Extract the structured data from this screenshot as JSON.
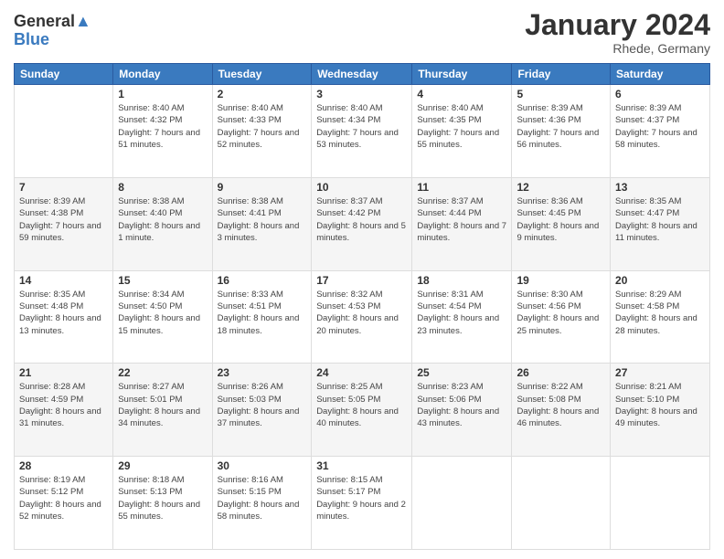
{
  "logo": {
    "general": "General",
    "blue": "Blue"
  },
  "title": "January 2024",
  "location": "Rhede, Germany",
  "days_of_week": [
    "Sunday",
    "Monday",
    "Tuesday",
    "Wednesday",
    "Thursday",
    "Friday",
    "Saturday"
  ],
  "weeks": [
    [
      {
        "day": "",
        "sunrise": "",
        "sunset": "",
        "daylight": ""
      },
      {
        "day": "1",
        "sunrise": "Sunrise: 8:40 AM",
        "sunset": "Sunset: 4:32 PM",
        "daylight": "Daylight: 7 hours and 51 minutes."
      },
      {
        "day": "2",
        "sunrise": "Sunrise: 8:40 AM",
        "sunset": "Sunset: 4:33 PM",
        "daylight": "Daylight: 7 hours and 52 minutes."
      },
      {
        "day": "3",
        "sunrise": "Sunrise: 8:40 AM",
        "sunset": "Sunset: 4:34 PM",
        "daylight": "Daylight: 7 hours and 53 minutes."
      },
      {
        "day": "4",
        "sunrise": "Sunrise: 8:40 AM",
        "sunset": "Sunset: 4:35 PM",
        "daylight": "Daylight: 7 hours and 55 minutes."
      },
      {
        "day": "5",
        "sunrise": "Sunrise: 8:39 AM",
        "sunset": "Sunset: 4:36 PM",
        "daylight": "Daylight: 7 hours and 56 minutes."
      },
      {
        "day": "6",
        "sunrise": "Sunrise: 8:39 AM",
        "sunset": "Sunset: 4:37 PM",
        "daylight": "Daylight: 7 hours and 58 minutes."
      }
    ],
    [
      {
        "day": "7",
        "sunrise": "Sunrise: 8:39 AM",
        "sunset": "Sunset: 4:38 PM",
        "daylight": "Daylight: 7 hours and 59 minutes."
      },
      {
        "day": "8",
        "sunrise": "Sunrise: 8:38 AM",
        "sunset": "Sunset: 4:40 PM",
        "daylight": "Daylight: 8 hours and 1 minute."
      },
      {
        "day": "9",
        "sunrise": "Sunrise: 8:38 AM",
        "sunset": "Sunset: 4:41 PM",
        "daylight": "Daylight: 8 hours and 3 minutes."
      },
      {
        "day": "10",
        "sunrise": "Sunrise: 8:37 AM",
        "sunset": "Sunset: 4:42 PM",
        "daylight": "Daylight: 8 hours and 5 minutes."
      },
      {
        "day": "11",
        "sunrise": "Sunrise: 8:37 AM",
        "sunset": "Sunset: 4:44 PM",
        "daylight": "Daylight: 8 hours and 7 minutes."
      },
      {
        "day": "12",
        "sunrise": "Sunrise: 8:36 AM",
        "sunset": "Sunset: 4:45 PM",
        "daylight": "Daylight: 8 hours and 9 minutes."
      },
      {
        "day": "13",
        "sunrise": "Sunrise: 8:35 AM",
        "sunset": "Sunset: 4:47 PM",
        "daylight": "Daylight: 8 hours and 11 minutes."
      }
    ],
    [
      {
        "day": "14",
        "sunrise": "Sunrise: 8:35 AM",
        "sunset": "Sunset: 4:48 PM",
        "daylight": "Daylight: 8 hours and 13 minutes."
      },
      {
        "day": "15",
        "sunrise": "Sunrise: 8:34 AM",
        "sunset": "Sunset: 4:50 PM",
        "daylight": "Daylight: 8 hours and 15 minutes."
      },
      {
        "day": "16",
        "sunrise": "Sunrise: 8:33 AM",
        "sunset": "Sunset: 4:51 PM",
        "daylight": "Daylight: 8 hours and 18 minutes."
      },
      {
        "day": "17",
        "sunrise": "Sunrise: 8:32 AM",
        "sunset": "Sunset: 4:53 PM",
        "daylight": "Daylight: 8 hours and 20 minutes."
      },
      {
        "day": "18",
        "sunrise": "Sunrise: 8:31 AM",
        "sunset": "Sunset: 4:54 PM",
        "daylight": "Daylight: 8 hours and 23 minutes."
      },
      {
        "day": "19",
        "sunrise": "Sunrise: 8:30 AM",
        "sunset": "Sunset: 4:56 PM",
        "daylight": "Daylight: 8 hours and 25 minutes."
      },
      {
        "day": "20",
        "sunrise": "Sunrise: 8:29 AM",
        "sunset": "Sunset: 4:58 PM",
        "daylight": "Daylight: 8 hours and 28 minutes."
      }
    ],
    [
      {
        "day": "21",
        "sunrise": "Sunrise: 8:28 AM",
        "sunset": "Sunset: 4:59 PM",
        "daylight": "Daylight: 8 hours and 31 minutes."
      },
      {
        "day": "22",
        "sunrise": "Sunrise: 8:27 AM",
        "sunset": "Sunset: 5:01 PM",
        "daylight": "Daylight: 8 hours and 34 minutes."
      },
      {
        "day": "23",
        "sunrise": "Sunrise: 8:26 AM",
        "sunset": "Sunset: 5:03 PM",
        "daylight": "Daylight: 8 hours and 37 minutes."
      },
      {
        "day": "24",
        "sunrise": "Sunrise: 8:25 AM",
        "sunset": "Sunset: 5:05 PM",
        "daylight": "Daylight: 8 hours and 40 minutes."
      },
      {
        "day": "25",
        "sunrise": "Sunrise: 8:23 AM",
        "sunset": "Sunset: 5:06 PM",
        "daylight": "Daylight: 8 hours and 43 minutes."
      },
      {
        "day": "26",
        "sunrise": "Sunrise: 8:22 AM",
        "sunset": "Sunset: 5:08 PM",
        "daylight": "Daylight: 8 hours and 46 minutes."
      },
      {
        "day": "27",
        "sunrise": "Sunrise: 8:21 AM",
        "sunset": "Sunset: 5:10 PM",
        "daylight": "Daylight: 8 hours and 49 minutes."
      }
    ],
    [
      {
        "day": "28",
        "sunrise": "Sunrise: 8:19 AM",
        "sunset": "Sunset: 5:12 PM",
        "daylight": "Daylight: 8 hours and 52 minutes."
      },
      {
        "day": "29",
        "sunrise": "Sunrise: 8:18 AM",
        "sunset": "Sunset: 5:13 PM",
        "daylight": "Daylight: 8 hours and 55 minutes."
      },
      {
        "day": "30",
        "sunrise": "Sunrise: 8:16 AM",
        "sunset": "Sunset: 5:15 PM",
        "daylight": "Daylight: 8 hours and 58 minutes."
      },
      {
        "day": "31",
        "sunrise": "Sunrise: 8:15 AM",
        "sunset": "Sunset: 5:17 PM",
        "daylight": "Daylight: 9 hours and 2 minutes."
      },
      {
        "day": "",
        "sunrise": "",
        "sunset": "",
        "daylight": ""
      },
      {
        "day": "",
        "sunrise": "",
        "sunset": "",
        "daylight": ""
      },
      {
        "day": "",
        "sunrise": "",
        "sunset": "",
        "daylight": ""
      }
    ]
  ]
}
